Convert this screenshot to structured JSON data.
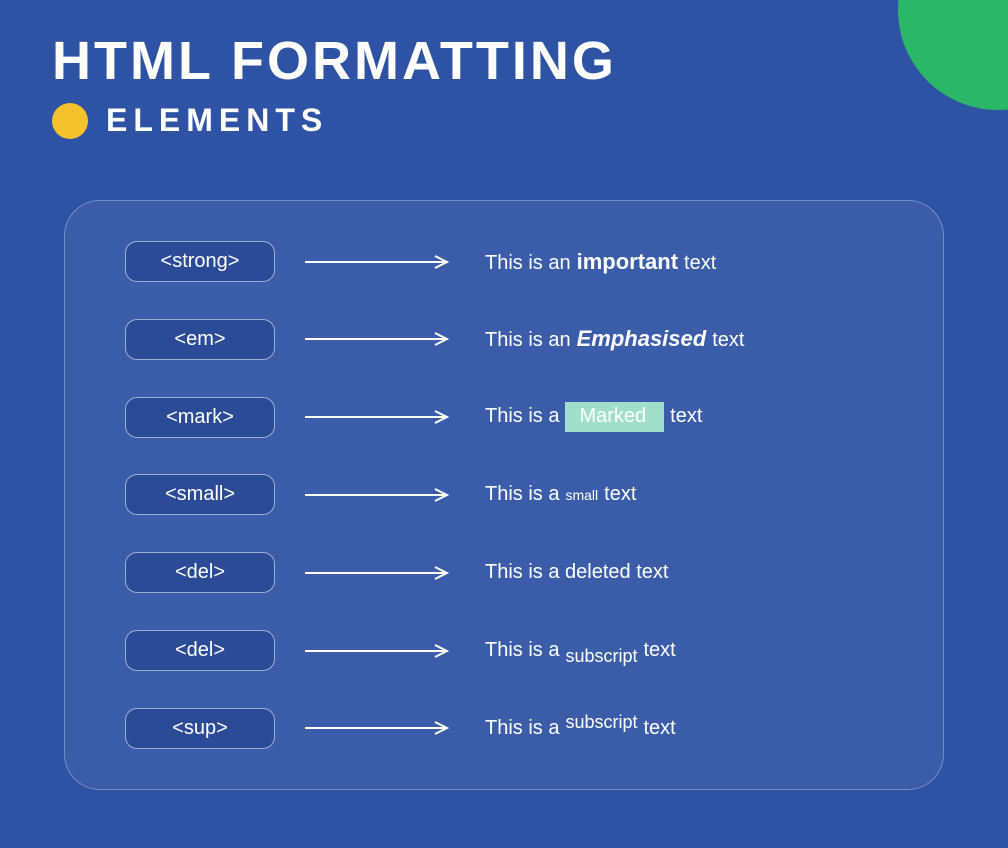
{
  "title": "HTML FORMATTING",
  "subtitle": "ELEMENTS",
  "rows": [
    {
      "tag": "<strong>",
      "prefix": "This is an",
      "effect": "important",
      "suffix": "text",
      "class": "eff-strong"
    },
    {
      "tag": "<em>",
      "prefix": "This is an",
      "effect": "Emphasised",
      "suffix": "text",
      "class": "eff-em"
    },
    {
      "tag": "<mark>",
      "prefix": "This is a",
      "effect": "Marked",
      "suffix": "text",
      "class": "eff-mark"
    },
    {
      "tag": "<small>",
      "prefix": "This is a",
      "effect": "small",
      "suffix": "text",
      "class": "eff-small"
    },
    {
      "tag": "<del>",
      "prefix": "This is a deleted text",
      "effect": "",
      "suffix": "",
      "class": ""
    },
    {
      "tag": "<del>",
      "prefix": "This is a",
      "effect": "subscript",
      "suffix": "text",
      "class": "eff-sub"
    },
    {
      "tag": "<sup>",
      "prefix": "This is a",
      "effect": "subscript",
      "suffix": "text",
      "class": "eff-sup"
    }
  ]
}
